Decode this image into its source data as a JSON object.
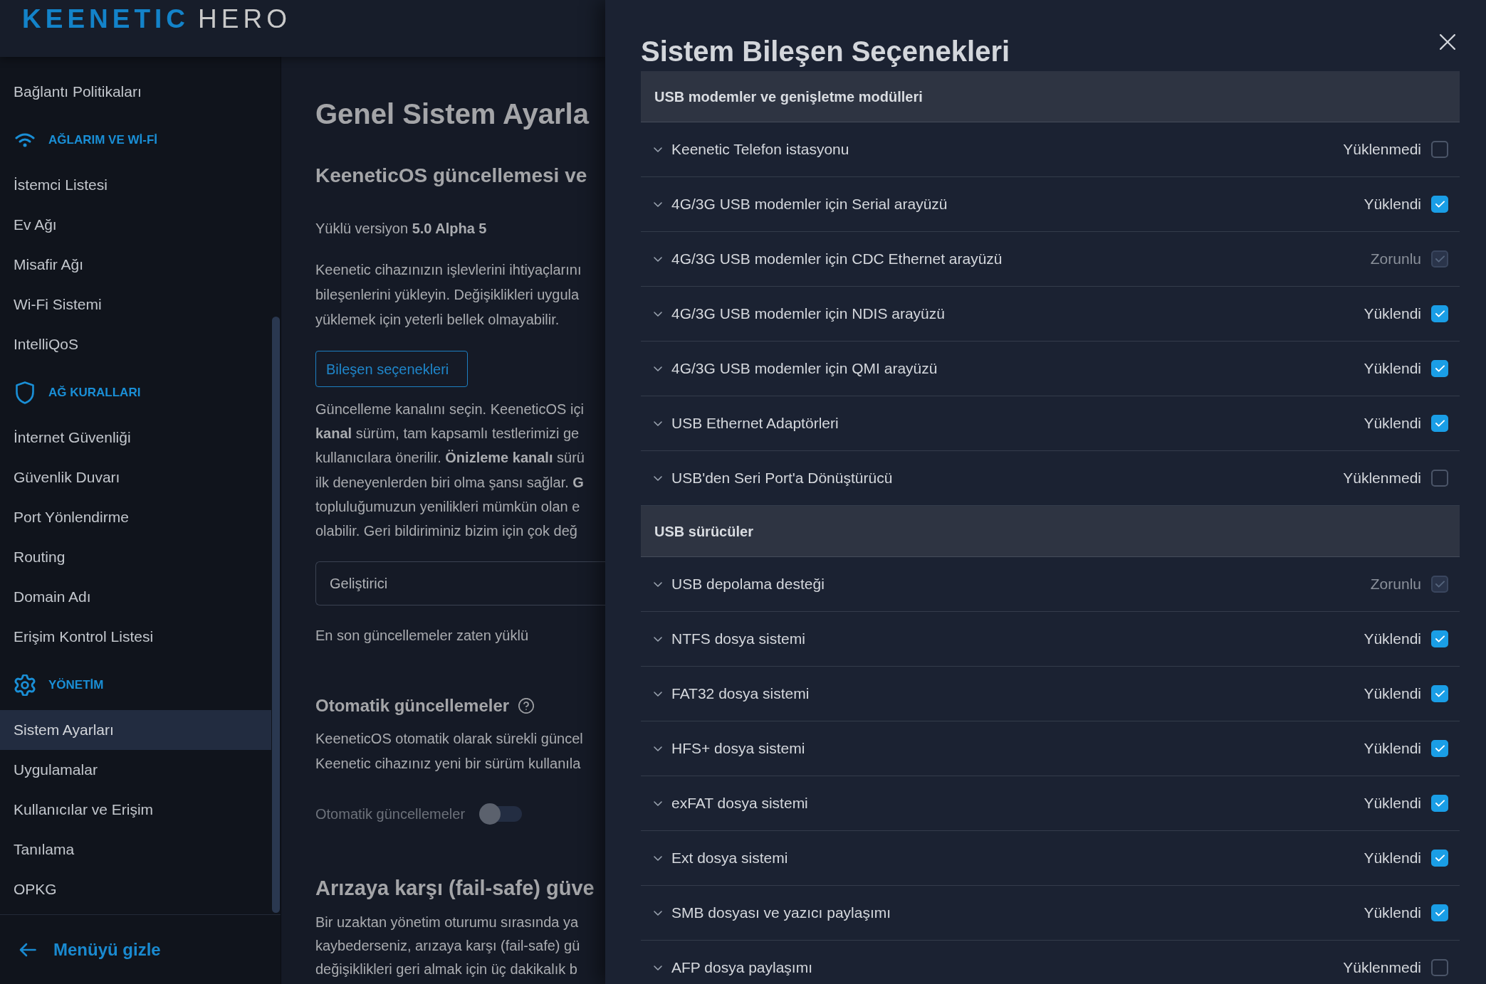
{
  "header": {
    "logo": {
      "brand": "KEENETIC",
      "model": "HERO"
    }
  },
  "sidebar": {
    "groups": [
      {
        "items": [
          {
            "label": "Bağlantı Politikaları",
            "selected": false
          }
        ]
      },
      {
        "title": "AĞLARIM VE Wİ-Fİ",
        "items": [
          {
            "label": "İstemci Listesi",
            "selected": false
          },
          {
            "label": "Ev Ağı",
            "selected": false
          },
          {
            "label": "Misafir Ağı",
            "selected": false
          },
          {
            "label": "Wi-Fi Sistemi",
            "selected": false
          },
          {
            "label": "IntelliQoS",
            "selected": false
          }
        ]
      },
      {
        "title": "AĞ KURALLARI",
        "items": [
          {
            "label": "İnternet Güvenliği",
            "selected": false
          },
          {
            "label": "Güvenlik Duvarı",
            "selected": false
          },
          {
            "label": "Port Yönlendirme",
            "selected": false
          },
          {
            "label": "Routing",
            "selected": false
          },
          {
            "label": "Domain Adı",
            "selected": false
          },
          {
            "label": "Erişim Kontrol Listesi",
            "selected": false
          }
        ]
      },
      {
        "title": "YÖNETİM",
        "items": [
          {
            "label": "Sistem Ayarları",
            "selected": true
          },
          {
            "label": "Uygulamalar",
            "selected": false
          },
          {
            "label": "Kullanıcılar ve Erişim",
            "selected": false
          },
          {
            "label": "Tanılama",
            "selected": false
          },
          {
            "label": "OPKG",
            "selected": false
          }
        ]
      }
    ],
    "hide_menu": "Menüyü gizle"
  },
  "main": {
    "title": "Genel Sistem Ayarla",
    "update_section": {
      "heading": "KeeneticOS güncellemesi ve",
      "installed_version": "Yüklü versiyon **5.0 Alpha 5**",
      "description_lines": [
        "Keenetic cihazınızın işlevlerini ihtiyaçlarını",
        "bileşenlerini yükleyin. Değişiklikleri uygula",
        "yüklemek için yeterli bellek olmayabilir."
      ],
      "components_button": "Bileşen seçenekleri",
      "channel_lines": [
        "Güncelleme kanalını seçin. KeeneticOS içi",
        "**kanal** sürüm, tam kapsamlı testlerimizi ge",
        "kullanıcılara önerilir. **Önizleme kanalı** sürü",
        "ilk deneyenlerden biri olma şansı sağlar. **G**",
        "topluluğumuzun yenilikleri mümkün olan e",
        "olabilir. Geri bildiriminiz bizim için çok değ"
      ],
      "channel_select": {
        "value": "Geliştirici"
      },
      "status": "En son güncellemeler zaten yüklü"
    },
    "auto_updates": {
      "heading": "Otomatik güncellemeler",
      "description_lines": [
        "KeeneticOS otomatik olarak sürekli güncel",
        "Keenetic cihazınız yeni bir sürüm kullanıla"
      ],
      "toggle": {
        "label": "Otomatik güncellemeler",
        "on": false,
        "disabled": true
      }
    },
    "failsafe": {
      "heading": "Arızaya karşı (fail-safe) güve",
      "description_lines": [
        "Bir uzaktan yönetim oturumu sırasında ya",
        "kaybederseniz, arızaya karşı (fail-safe) gü",
        "değişiklikleri geri almak için üç dakikalık b"
      ]
    }
  },
  "drawer": {
    "title": "Sistem Bileşen Seçenekleri",
    "sections": [
      {
        "title": "USB modemler ve genişletme modülleri",
        "components": [
          {
            "name": "Keenetic Telefon istasyonu",
            "status": "Yüklenmedi",
            "checked": false,
            "disabled": false
          },
          {
            "name": "4G/3G USB modemler için Serial arayüzü",
            "status": "Yüklendi",
            "checked": true,
            "disabled": false
          },
          {
            "name": "4G/3G USB modemler için CDC Ethernet arayüzü",
            "status": "Zorunlu",
            "checked": true,
            "disabled": true
          },
          {
            "name": "4G/3G USB modemler için NDIS arayüzü",
            "status": "Yüklendi",
            "checked": true,
            "disabled": false
          },
          {
            "name": "4G/3G USB modemler için QMI arayüzü",
            "status": "Yüklendi",
            "checked": true,
            "disabled": false
          },
          {
            "name": "USB Ethernet Adaptörleri",
            "status": "Yüklendi",
            "checked": true,
            "disabled": false
          },
          {
            "name": "USB'den Seri Port'a Dönüştürücü",
            "status": "Yüklenmedi",
            "checked": false,
            "disabled": false
          }
        ]
      },
      {
        "title": "USB sürücüler",
        "components": [
          {
            "name": "USB depolama desteği",
            "status": "Zorunlu",
            "checked": true,
            "disabled": true
          },
          {
            "name": "NTFS dosya sistemi",
            "status": "Yüklendi",
            "checked": true,
            "disabled": false
          },
          {
            "name": "FAT32 dosya sistemi",
            "status": "Yüklendi",
            "checked": true,
            "disabled": false
          },
          {
            "name": "HFS+ dosya sistemi",
            "status": "Yüklendi",
            "checked": true,
            "disabled": false
          },
          {
            "name": "exFAT dosya sistemi",
            "status": "Yüklendi",
            "checked": true,
            "disabled": false
          },
          {
            "name": "Ext dosya sistemi",
            "status": "Yüklendi",
            "checked": true,
            "disabled": false
          },
          {
            "name": "SMB dosyası ve yazıcı paylaşımı",
            "status": "Yüklendi",
            "checked": true,
            "disabled": false
          },
          {
            "name": "AFP dosya paylaşımı",
            "status": "Yüklenmedi",
            "checked": false,
            "disabled": false
          }
        ]
      }
    ]
  }
}
